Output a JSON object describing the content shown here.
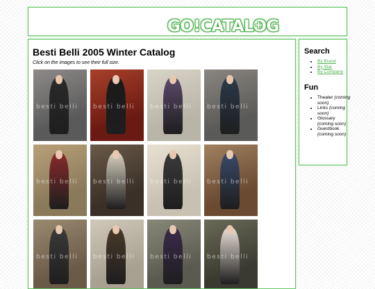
{
  "header": {
    "logo_text": "GO!CATALOG",
    "logo_plus": "+"
  },
  "main": {
    "title": "Besti Belli 2005 Winter Catalog",
    "instructions": "Click on the images to see their full size.",
    "thumbnails": [
      {
        "watermark": "besti belli",
        "colors": [
          "#5a5a5a",
          "#8d8a88",
          "#2a2a2a"
        ]
      },
      {
        "watermark": "besti belli",
        "colors": [
          "#6a1a12",
          "#a8402a",
          "#1a1a1a"
        ]
      },
      {
        "watermark": "besti belli",
        "colors": [
          "#b8b4a8",
          "#d8d4c8",
          "#5a4a6a"
        ]
      },
      {
        "watermark": "besti belli",
        "colors": [
          "#5a5a58",
          "#8a8680",
          "#2a3a4a"
        ]
      },
      {
        "watermark": "besti belli",
        "colors": [
          "#8a7a5a",
          "#b8a078",
          "#8a2a2a"
        ]
      },
      {
        "watermark": "besti belli",
        "colors": [
          "#3a3028",
          "#6a5a48",
          "#d8d0c0"
        ]
      },
      {
        "watermark": "besti belli",
        "colors": [
          "#c8c0b0",
          "#e8e0d0",
          "#3a3a3a"
        ]
      },
      {
        "watermark": "besti belli",
        "colors": [
          "#6a4a30",
          "#a08060",
          "#3a4a6a"
        ]
      },
      {
        "watermark": "besti belli",
        "colors": [
          "#6a5a48",
          "#9a8a70",
          "#3a3a3a"
        ]
      },
      {
        "watermark": "besti belli",
        "colors": [
          "#a8a090",
          "#d0c8b8",
          "#4a3a2a"
        ]
      },
      {
        "watermark": "besti belli",
        "colors": [
          "#5a5a50",
          "#888878",
          "#3a2a4a"
        ]
      },
      {
        "watermark": "besti belli",
        "colors": [
          "#3a3a30",
          "#6a6a58",
          "#e8e0d8"
        ]
      }
    ]
  },
  "sidebar": {
    "search_heading": "Search",
    "search_links": [
      "By Brand",
      "By Star",
      "By Company"
    ],
    "fun_heading": "Fun",
    "fun_items": [
      {
        "label": "Theater",
        "note": "(coming soon)"
      },
      {
        "label": "Links",
        "note": "(coming soon)"
      },
      {
        "label": "Glossary",
        "note": "(coming soon)"
      },
      {
        "label": "Guestbook",
        "note": "(coming soon)"
      }
    ]
  }
}
